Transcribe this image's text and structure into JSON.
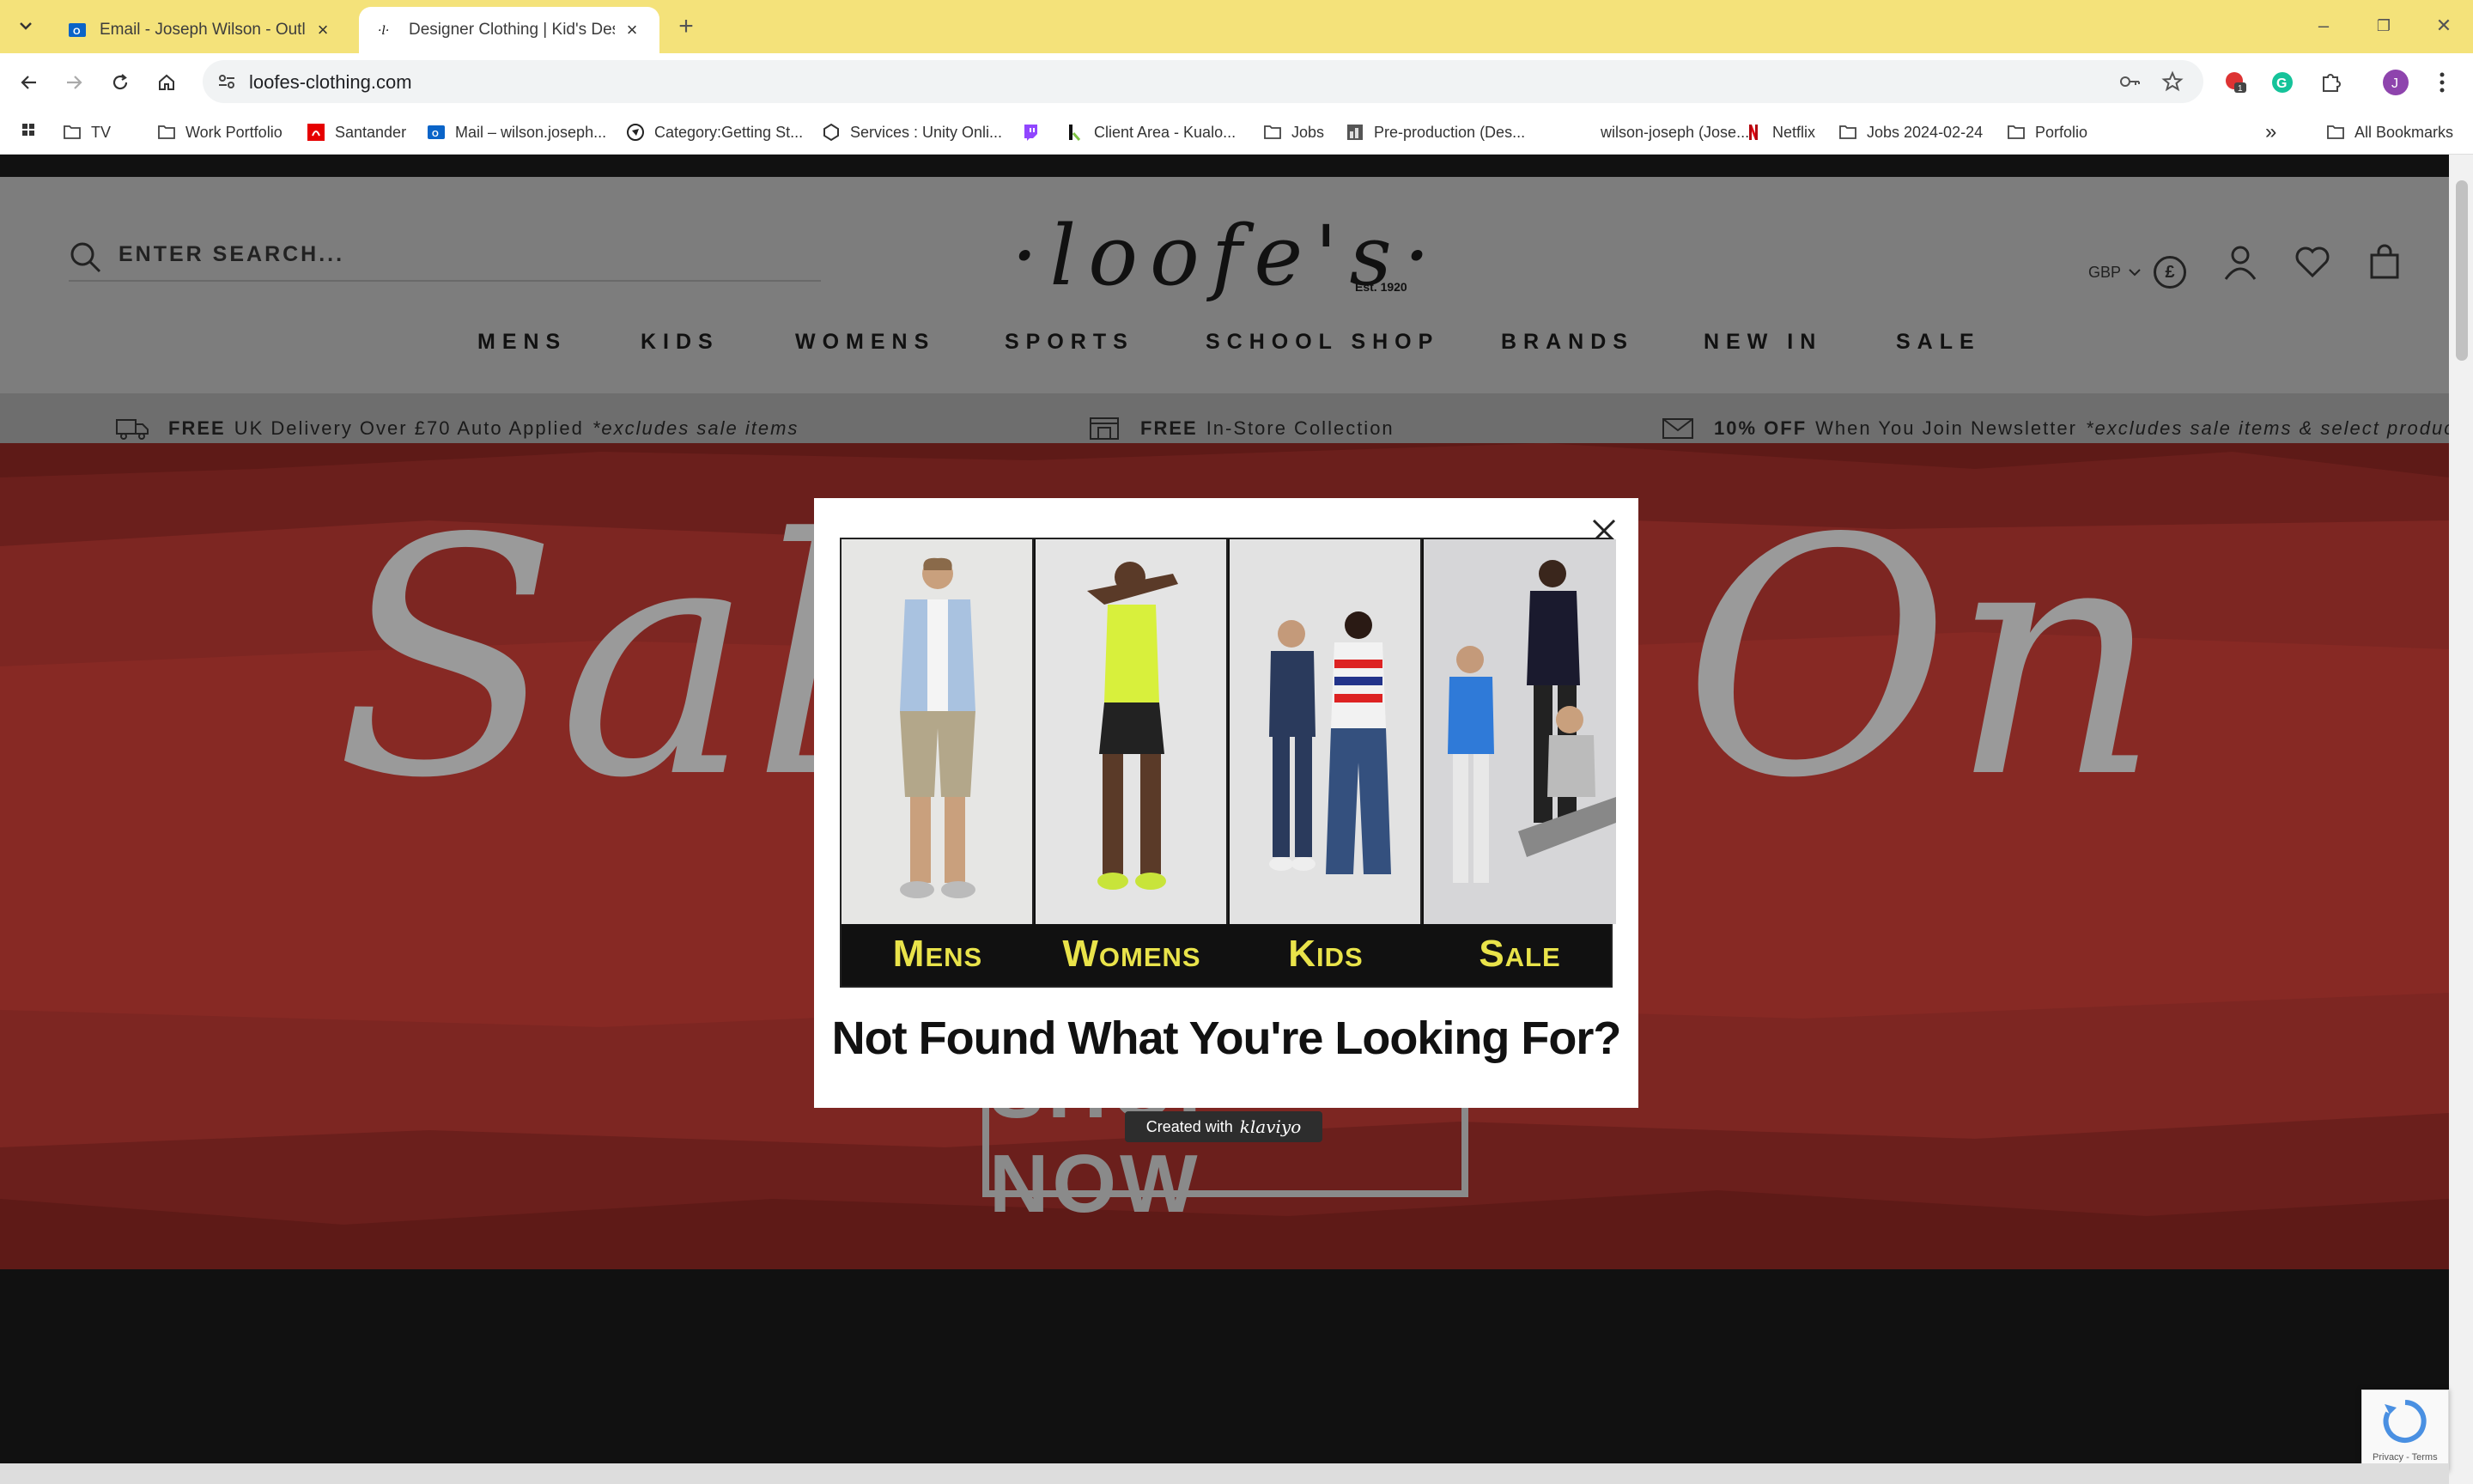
{
  "browser": {
    "tabs": [
      {
        "title": "Email - Joseph Wilson - Outlook",
        "active": false
      },
      {
        "title": "Designer Clothing | Kid's Designer",
        "active": true
      }
    ],
    "new_tab": "+",
    "url": "loofes-clothing.com",
    "window_controls": {
      "minimize": "–",
      "restore": "❐",
      "close": "✕"
    }
  },
  "bookmarks": [
    {
      "label": "TV",
      "icon": "folder-icon"
    },
    {
      "label": "Work Portfolio",
      "icon": "folder-icon"
    },
    {
      "label": "Santander",
      "icon": "santander-icon"
    },
    {
      "label": "Mail – wilson.joseph...",
      "icon": "outlook-icon"
    },
    {
      "label": "Category:Getting St...",
      "icon": "globe-icon"
    },
    {
      "label": "Services : Unity Onli...",
      "icon": "unity-icon"
    },
    {
      "label": "",
      "icon": "twitch-icon"
    },
    {
      "label": "Client Area - Kualo...",
      "icon": "kualo-icon"
    },
    {
      "label": "Jobs",
      "icon": "folder-icon"
    },
    {
      "label": "Pre-production (Des...",
      "icon": "image-icon"
    },
    {
      "label": "wilson-joseph (Jose...",
      "icon": "blank-icon"
    },
    {
      "label": "Netflix",
      "icon": "netflix-icon"
    },
    {
      "label": "Jobs 2024-02-24",
      "icon": "folder-icon"
    },
    {
      "label": "Porfolio",
      "icon": "folder-icon"
    }
  ],
  "bookmarks_overflow": "»",
  "all_bookmarks": "All Bookmarks",
  "site": {
    "search_placeholder": "ENTER SEARCH...",
    "logo": "·loofe's·",
    "logo_est": "Est. 1920",
    "currency": "GBP",
    "currency_symbol": "£",
    "nav": [
      "MENS",
      "KIDS",
      "WOMENS",
      "SPORTS",
      "SCHOOL SHOP",
      "BRANDS",
      "NEW IN",
      "SALE"
    ],
    "promos": [
      {
        "bold": "FREE",
        "text": "UK Delivery Over £70 Auto Applied",
        "italic": "*excludes sale items"
      },
      {
        "bold": "FREE",
        "text": "In-Store Collection",
        "italic": ""
      },
      {
        "bold": "10% OFF",
        "text": "When You Join Newsletter",
        "italic": "*excludes sale items & select products"
      }
    ],
    "hero_title_left": "Sale",
    "hero_title_right": "On",
    "hero_button": "SHOP NOW"
  },
  "modal": {
    "categories": [
      "Mens",
      "Womens",
      "Kids",
      "Sale"
    ],
    "heading": "Not Found What You're Looking For?",
    "badge_prefix": "Created with",
    "badge_brand": "klaviyo"
  },
  "recaptcha_text": "Privacy - Terms",
  "colors": {
    "tabbar": "#f4e27a",
    "hero_red": "#b03a2e",
    "modal_label_yellow": "#e9e34a"
  }
}
